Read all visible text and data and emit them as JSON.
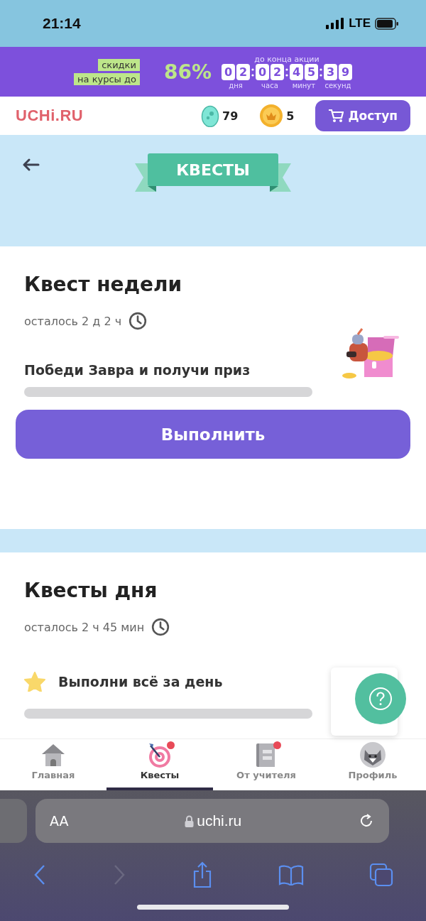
{
  "status_bar": {
    "time": "21:14",
    "network": "LTE"
  },
  "promo": {
    "labels": [
      "скидки",
      "на курсы до"
    ],
    "percent": "86%",
    "caption": "до конца акции",
    "timer": [
      {
        "digits": [
          "0",
          "2"
        ],
        "unit": "дня"
      },
      {
        "digits": [
          "0",
          "2"
        ],
        "unit": "часа"
      },
      {
        "digits": [
          "4",
          "5"
        ],
        "unit": "минут"
      },
      {
        "digits": [
          "3",
          "9"
        ],
        "unit": "секунд"
      }
    ]
  },
  "header": {
    "logo": "UCHi.RU",
    "eggs": "79",
    "coins": "5",
    "access_button": "Доступ"
  },
  "banner": {
    "title": "КВЕСТЫ"
  },
  "weekly": {
    "title": "Квест недели",
    "remaining": "осталось 2 д 2 ч",
    "task": "Победи Завра и получи приз",
    "level": 0,
    "button": "Выполнить"
  },
  "daily": {
    "title": "Квесты дня",
    "remaining": "осталось 2 ч 45 мин",
    "task": "Выполни всё за день",
    "level": 0
  },
  "tabs": [
    {
      "label": "Главная",
      "selected": false,
      "badge": false
    },
    {
      "label": "Квесты",
      "selected": true,
      "badge": true
    },
    {
      "label": "От учителя",
      "selected": false,
      "badge": true
    },
    {
      "label": "Профиль",
      "selected": false,
      "badge": false
    }
  ],
  "browser": {
    "text_size": "AA",
    "url": "uchi.ru",
    "forward_disabled": true
  }
}
